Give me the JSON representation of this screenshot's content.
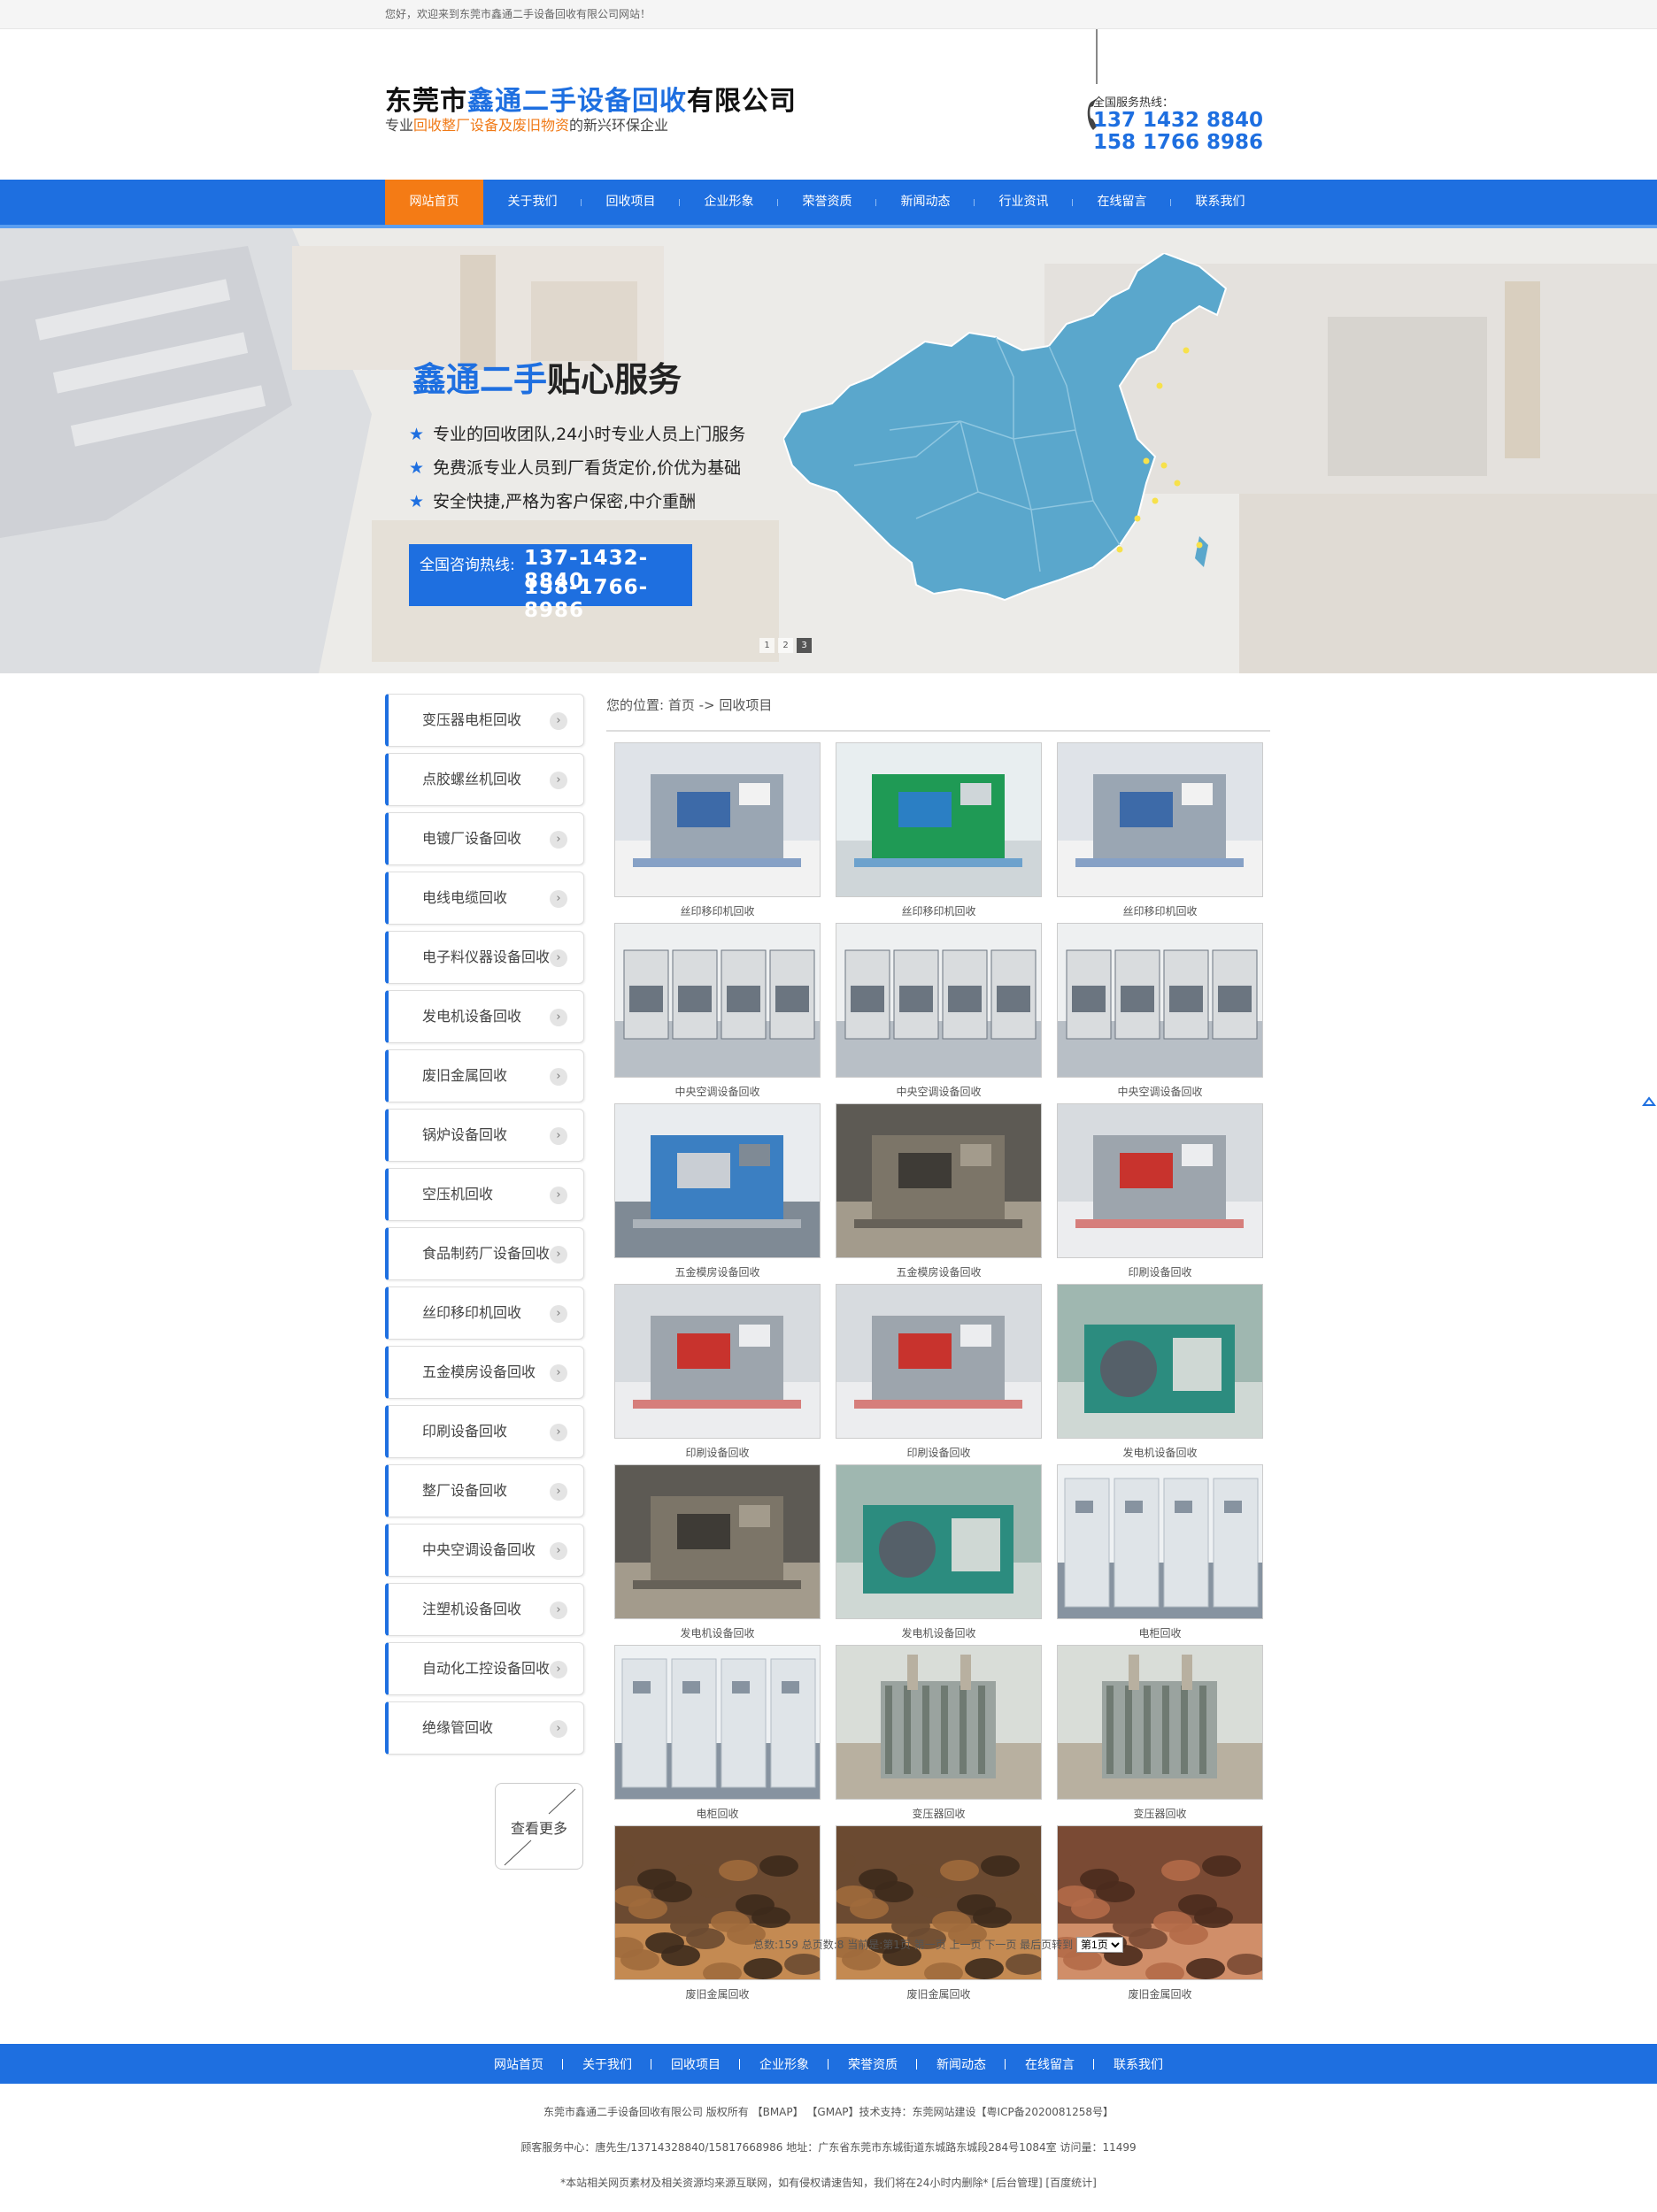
{
  "topbar": {
    "welcome": "您好，欢迎来到东莞市鑫通二手设备回收有限公司网站！"
  },
  "header": {
    "title_pre": "东莞市",
    "title_hl": "鑫通二手设备回收",
    "title_post": "有限公司",
    "sub_pre": "专业",
    "sub_or": "回收整厂设备及废旧物资",
    "sub_post": "的新兴环保企业",
    "hotline_label": "全国服务热线：",
    "phone1": "137 1432 8840",
    "phone2": "158 1766 8986",
    "colors": {
      "brand": "#1e6fe0",
      "accent": "#f47b15"
    }
  },
  "nav": {
    "items": [
      "网站首页",
      "关于我们",
      "回收项目",
      "企业形象",
      "荣誉资质",
      "新闻动态",
      "行业资讯",
      "在线留言",
      "联系我们"
    ],
    "active": 0
  },
  "banner": {
    "title_blue": "鑫通二手",
    "title_dark": "贴心服务",
    "items": [
      "专业的回收团队,24小时专业人员上门服务",
      "免费派专业人员到厂看货定价,价优为基础",
      "安全快捷,严格为客户保密,中介重酬"
    ],
    "star": "★",
    "box_label": "全国咨询热线:",
    "box_phone1": "137-1432-8840",
    "box_phone2": "158-1766-8986",
    "dots": [
      "1",
      "2",
      "3"
    ],
    "active_dot": 2
  },
  "sidebar": {
    "items": [
      "变压器电柜回收",
      "点胶螺丝机回收",
      "电镀厂设备回收",
      "电线电缆回收",
      "电子料仪器设备回收",
      "发电机设备回收",
      "废旧金属回收",
      "锅炉设备回收",
      "空压机回收",
      "食品制药厂设备回收",
      "丝印移印机回收",
      "五金模房设备回收",
      "印刷设备回收",
      "整厂设备回收",
      "中央空调设备回收",
      "注塑机设备回收",
      "自动化工控设备回收",
      "绝缘管回收"
    ],
    "arrow": "›",
    "more": "查看更多"
  },
  "breadcrumb": {
    "label": "您的位置:",
    "home": "首页",
    "sep": "->",
    "current": "回收项目"
  },
  "products": [
    {
      "caption": "丝印移印机回收",
      "kind": "machine"
    },
    {
      "caption": "丝印移印机回收",
      "kind": "green"
    },
    {
      "caption": "丝印移印机回收",
      "kind": "machine"
    },
    {
      "caption": "中央空调设备回收",
      "kind": "ac"
    },
    {
      "caption": "中央空调设备回收",
      "kind": "ac"
    },
    {
      "caption": "中央空调设备回收",
      "kind": "ac"
    },
    {
      "caption": "五金模房设备回收",
      "kind": "factory"
    },
    {
      "caption": "五金模房设备回收",
      "kind": "dark"
    },
    {
      "caption": "印刷设备回收",
      "kind": "print"
    },
    {
      "caption": "印刷设备回收",
      "kind": "print"
    },
    {
      "caption": "印刷设备回收",
      "kind": "print"
    },
    {
      "caption": "发电机设备回收",
      "kind": "gen"
    },
    {
      "caption": "发电机设备回收",
      "kind": "dark"
    },
    {
      "caption": "发电机设备回收",
      "kind": "gen"
    },
    {
      "caption": "电柜回收",
      "kind": "cabinet"
    },
    {
      "caption": "电柜回收",
      "kind": "cabinet"
    },
    {
      "caption": "变压器回收",
      "kind": "transformer"
    },
    {
      "caption": "变压器回收",
      "kind": "transformer"
    },
    {
      "caption": "废旧金属回收",
      "kind": "metal"
    },
    {
      "caption": "废旧金属回收",
      "kind": "metal"
    },
    {
      "caption": "废旧金属回收",
      "kind": "metal2"
    }
  ],
  "pager": {
    "text": "总数:159   总页数:8   当前是:第1页  第一页   上一页   下一页   最后页转到",
    "select": "第1页"
  },
  "footer_nav": [
    "网站首页",
    "关于我们",
    "回收项目",
    "企业形象",
    "荣誉资质",
    "新闻动态",
    "在线留言",
    "联系我们"
  ],
  "footer": {
    "line1": "东莞市鑫通二手设备回收有限公司 版权所有 【BMAP】 【GMAP】技术支持：东莞网站建设【粤ICP备2020081258号】",
    "line2": "顾客服务中心：唐先生/13714328840/15817668986 地址：广东省东莞市东城街道东城路东城段284号1084室 访问量：11499",
    "line3": "*本站相关网页素材及相关资源均来源互联网，如有侵权请速告知，我们将在24小时内删除* [后台管理] [百度统计]"
  },
  "side_fix_icon": "chat-icon"
}
